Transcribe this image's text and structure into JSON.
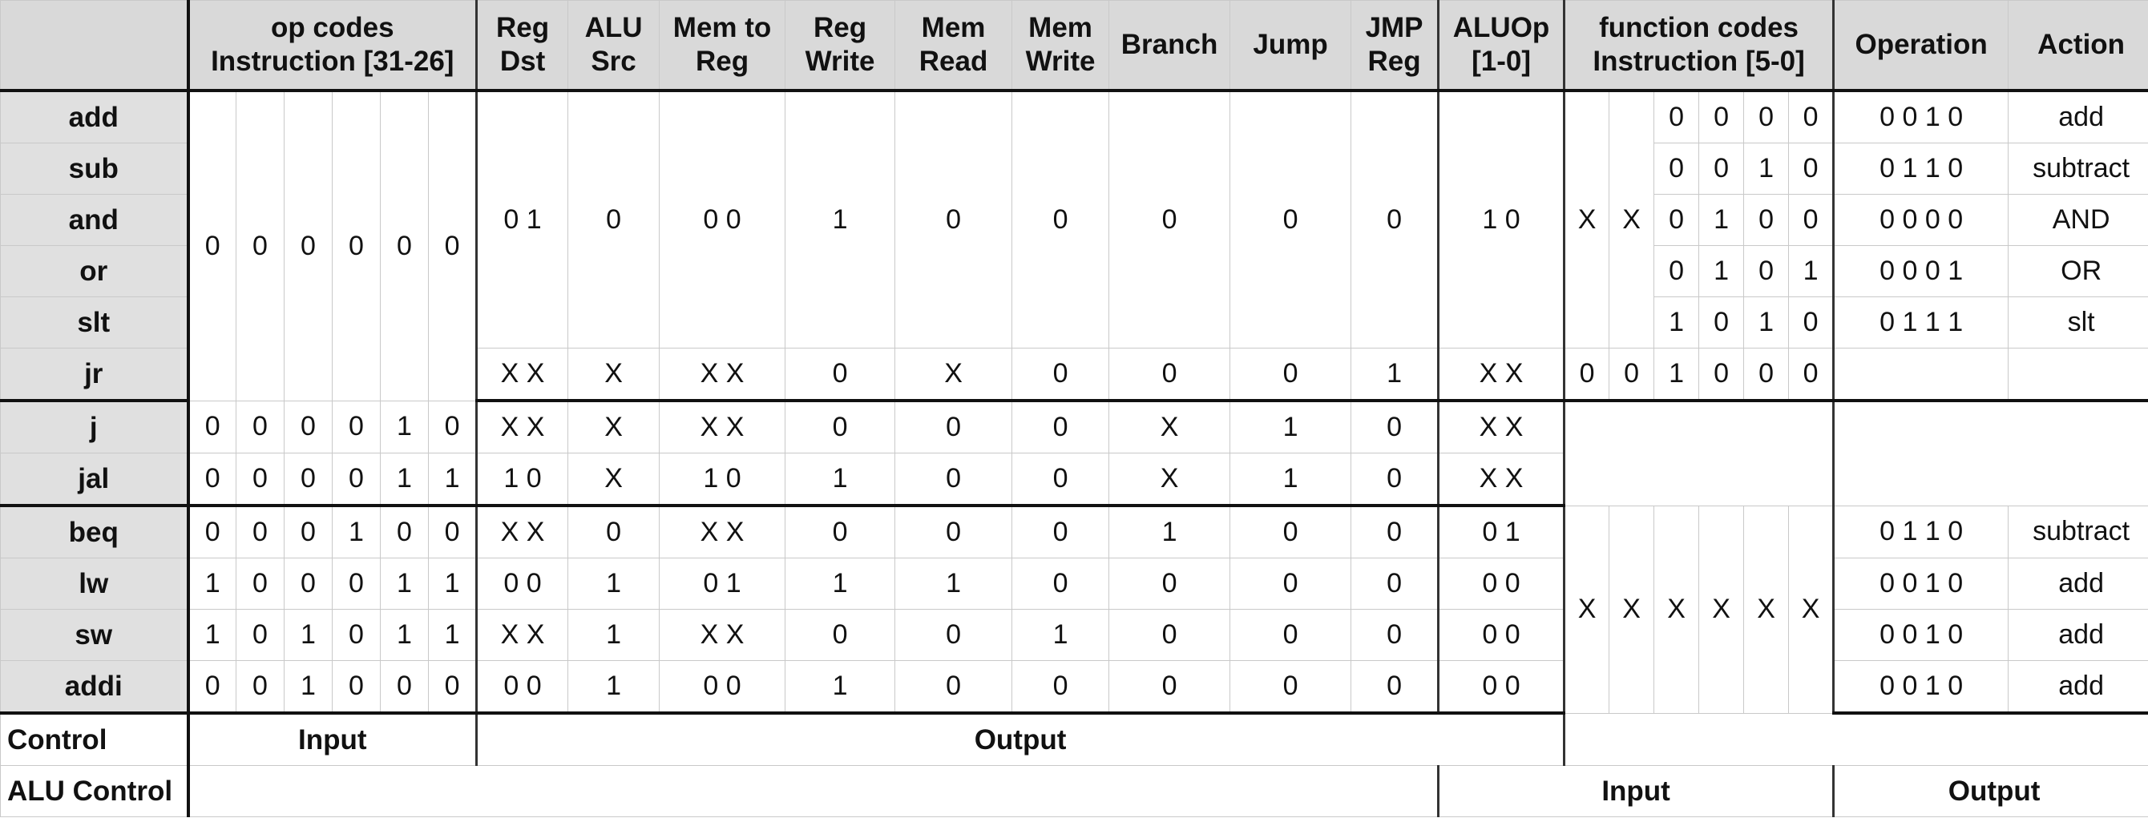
{
  "header": {
    "op_codes": [
      "op codes",
      "Instruction [31-26]"
    ],
    "reg_dst": [
      "Reg",
      "Dst"
    ],
    "alu_src": [
      "ALU",
      "Src"
    ],
    "mem_to_reg": [
      "Mem to",
      "Reg"
    ],
    "reg_write": [
      "Reg",
      "Write"
    ],
    "mem_read": [
      "Mem",
      "Read"
    ],
    "mem_write": [
      "Mem",
      "Write"
    ],
    "branch": "Branch",
    "jump": "Jump",
    "jmp_reg": [
      "JMP",
      "Reg"
    ],
    "aluop": [
      "ALUOp",
      "[1-0]"
    ],
    "function_codes": [
      "function codes",
      "Instruction [5-0]"
    ],
    "operation": "Operation",
    "action": "Action"
  },
  "instructions": [
    "add",
    "sub",
    "and",
    "or",
    "slt",
    "jr",
    "j",
    "jal",
    "beq",
    "lw",
    "sw",
    "addi"
  ],
  "rtype": {
    "opcode": [
      "0",
      "0",
      "0",
      "0",
      "0",
      "0"
    ],
    "reg_dst": "0 1",
    "alu_src": "0",
    "mem_to_reg": "0 0",
    "reg_write": "1",
    "mem_read": "0",
    "mem_write": "0",
    "branch": "0",
    "jump": "0",
    "jmp_reg": "0",
    "aluop": "1 0",
    "funct_hi": [
      "X",
      "X"
    ],
    "funct_lo": [
      [
        "0",
        "0",
        "0",
        "0"
      ],
      [
        "0",
        "0",
        "1",
        "0"
      ],
      [
        "0",
        "1",
        "0",
        "0"
      ],
      [
        "0",
        "1",
        "0",
        "1"
      ],
      [
        "1",
        "0",
        "1",
        "0"
      ]
    ],
    "operation": [
      "0 0 1 0",
      "0 1 1 0",
      "0 0 0 0",
      "0 0 0 1",
      "0 1 1 1"
    ],
    "action": [
      "add",
      "subtract",
      "AND",
      "OR",
      "slt"
    ]
  },
  "jr": {
    "reg_dst": "X X",
    "alu_src": "X",
    "mem_to_reg": "X X",
    "reg_write": "0",
    "mem_read": "X",
    "mem_write": "0",
    "branch": "0",
    "jump": "0",
    "jmp_reg": "1",
    "aluop": "X X",
    "funct": [
      "0",
      "0",
      "1",
      "0",
      "0",
      "0"
    ]
  },
  "jtype": [
    {
      "opcode": [
        "0",
        "0",
        "0",
        "0",
        "1",
        "0"
      ],
      "reg_dst": "X X",
      "alu_src": "X",
      "mem_to_reg": "X X",
      "reg_write": "0",
      "mem_read": "0",
      "mem_write": "0",
      "branch": "X",
      "jump": "1",
      "jmp_reg": "0",
      "aluop": "X X"
    },
    {
      "opcode": [
        "0",
        "0",
        "0",
        "0",
        "1",
        "1"
      ],
      "reg_dst": "1 0",
      "alu_src": "X",
      "mem_to_reg": "1 0",
      "reg_write": "1",
      "mem_read": "0",
      "mem_write": "0",
      "branch": "X",
      "jump": "1",
      "jmp_reg": "0",
      "aluop": "X X"
    }
  ],
  "itype": [
    {
      "opcode": [
        "0",
        "0",
        "0",
        "1",
        "0",
        "0"
      ],
      "reg_dst": "X X",
      "alu_src": "0",
      "mem_to_reg": "X X",
      "reg_write": "0",
      "mem_read": "0",
      "mem_write": "0",
      "branch": "1",
      "jump": "0",
      "jmp_reg": "0",
      "aluop": "0 1",
      "operation": "0 1 1 0",
      "action": "subtract"
    },
    {
      "opcode": [
        "1",
        "0",
        "0",
        "0",
        "1",
        "1"
      ],
      "reg_dst": "0 0",
      "alu_src": "1",
      "mem_to_reg": "0 1",
      "reg_write": "1",
      "mem_read": "1",
      "mem_write": "0",
      "branch": "0",
      "jump": "0",
      "jmp_reg": "0",
      "aluop": "0 0",
      "operation": "0 0 1 0",
      "action": "add"
    },
    {
      "opcode": [
        "1",
        "0",
        "1",
        "0",
        "1",
        "1"
      ],
      "reg_dst": "X X",
      "alu_src": "1",
      "mem_to_reg": "X X",
      "reg_write": "0",
      "mem_read": "0",
      "mem_write": "1",
      "branch": "0",
      "jump": "0",
      "jmp_reg": "0",
      "aluop": "0 0",
      "operation": "0 0 1 0",
      "action": "add"
    },
    {
      "opcode": [
        "0",
        "0",
        "1",
        "0",
        "0",
        "0"
      ],
      "reg_dst": "0 0",
      "alu_src": "1",
      "mem_to_reg": "0 0",
      "reg_write": "1",
      "mem_read": "0",
      "mem_write": "0",
      "branch": "0",
      "jump": "0",
      "jmp_reg": "0",
      "aluop": "0 0",
      "operation": "0 0 1 0",
      "action": "add"
    }
  ],
  "itype_funct": [
    "X",
    "X",
    "X",
    "X",
    "X",
    "X"
  ],
  "footer": {
    "control_label": "Control",
    "control_input": "Input",
    "control_output": "Output",
    "alu_control_label": "ALU Control",
    "alu_input": "Input",
    "alu_output": "Output"
  }
}
